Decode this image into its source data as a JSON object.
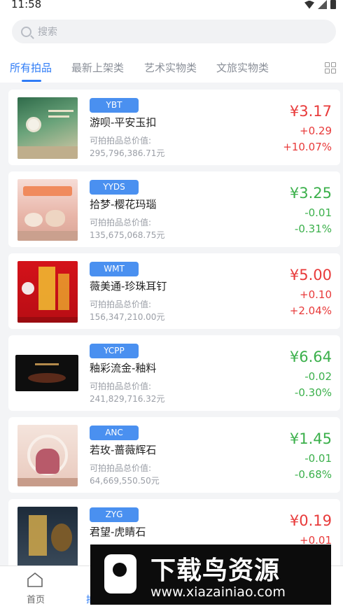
{
  "status": {
    "time": "11:58"
  },
  "search": {
    "placeholder": "搜索"
  },
  "tabs": [
    "所有拍品",
    "最新上架类",
    "艺术实物类",
    "文旅实物类"
  ],
  "items": [
    {
      "code": "YBT",
      "name": "游呗-平安玉扣",
      "value_label": "可拍拍品总价值:",
      "value": "295,796,386.71元",
      "price": "¥3.17",
      "change": "+0.29",
      "percent": "+10.07%",
      "trend": "up"
    },
    {
      "code": "YYDS",
      "name": "拾梦-樱花玛瑙",
      "value_label": "可拍拍品总价值:",
      "value": "135,675,068.75元",
      "price": "¥3.25",
      "change": "-0.01",
      "percent": "-0.31%",
      "trend": "down"
    },
    {
      "code": "WMT",
      "name": "薇美通-珍珠耳钉",
      "value_label": "可拍拍品总价值:",
      "value": "156,347,210.00元",
      "price": "¥5.00",
      "change": "+0.10",
      "percent": "+2.04%",
      "trend": "up"
    },
    {
      "code": "YCPP",
      "name": "釉彩流金-釉料",
      "value_label": "可拍拍品总价值:",
      "value": "241,829,716.32元",
      "price": "¥6.64",
      "change": "-0.02",
      "percent": "-0.30%",
      "trend": "down"
    },
    {
      "code": "ANC",
      "name": "若玫-蔷薇辉石",
      "value_label": "可拍拍品总价值:",
      "value": "64,669,550.50元",
      "price": "¥1.45",
      "change": "-0.01",
      "percent": "-0.68%",
      "trend": "down"
    },
    {
      "code": "ZYG",
      "name": "君望-虎睛石",
      "value_label": "",
      "value": "",
      "price": "¥0.19",
      "change": "+0.01",
      "percent": "",
      "trend": "up"
    }
  ],
  "bottom_nav": {
    "home": "首页",
    "second": "拍"
  },
  "watermark": {
    "title": "下载鸟资源",
    "url": "www.xiazainiao.com"
  },
  "colors": {
    "accent": "#2f7cf6",
    "up": "#e83a3a",
    "down": "#3bb04b",
    "code_badge": "#4a90f0"
  }
}
